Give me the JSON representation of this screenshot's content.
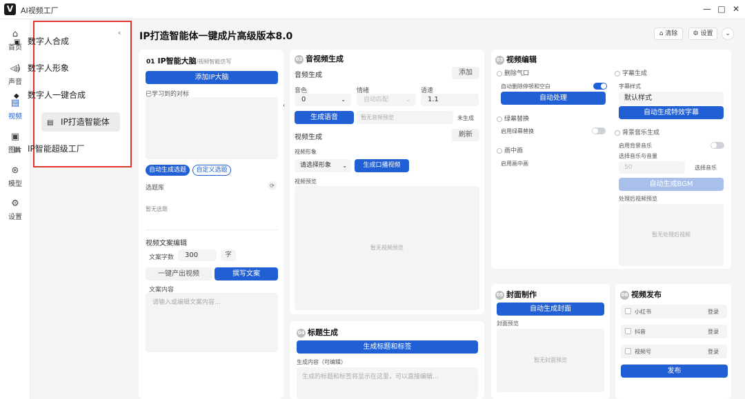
{
  "app": {
    "logo": "V",
    "title": "AI视频工厂"
  },
  "window": {
    "minimize": "—",
    "maximize": "□",
    "close": "✕"
  },
  "nav": [
    {
      "icon": "⌂",
      "label": "首页"
    },
    {
      "icon": "◁)",
      "label": "声音"
    },
    {
      "icon": "▤",
      "label": "视频"
    },
    {
      "icon": "▣",
      "label": "图片"
    },
    {
      "icon": "⊛",
      "label": "模型"
    },
    {
      "icon": "⚙",
      "label": "设置"
    }
  ],
  "submenu": {
    "collapse": "‹",
    "items": [
      {
        "icon": "▣",
        "label": "数字人合成"
      },
      {
        "icon": "▭",
        "label": "数字人形象"
      },
      {
        "icon": "◆",
        "label": "数字人一键合成"
      },
      {
        "icon": "▤",
        "label": "IP打造智能体"
      },
      {
        "icon": "▤",
        "label": "IP智能超级工厂"
      }
    ]
  },
  "header": {
    "title": "IP打造智能体一键成片高级版本8.0",
    "clear": "清除",
    "settings": "设置",
    "more": "⌄"
  },
  "s1": {
    "num": "01",
    "title": "IP智能大脑",
    "subtitle": "/视频智能仿写",
    "add_brain": "添加IP大脑",
    "learned_label": "已学习到的对标",
    "auto_topic": "自动生成选题",
    "custom_topic": "自定义选题",
    "topic_lib": "选题库",
    "refresh_icon": "⟳",
    "no_topic": "暂无选题",
    "copy_edit": "视频文案编辑",
    "word_count_label": "文案字数",
    "word_count": "300",
    "word_unit": "字",
    "one_click": "一键产出视频",
    "write_copy": "撰写文案",
    "content_label": "文案内容",
    "content_placeholder": "请输入或编辑文案内容..."
  },
  "s2": {
    "num": "02",
    "title": "音视频生成",
    "audio_gen": "音频生成",
    "add": "添加",
    "timbre_label": "音色",
    "timbre": "0",
    "emotion_label": "情绪",
    "emotion": "自动匹配",
    "speed_label": "语速",
    "speed": "1.1",
    "gen_voice": "生成语音",
    "no_audio": "暂无音频预览",
    "not_generated": "未生成",
    "video_gen": "视频生成",
    "refresh": "刷新",
    "figure_label": "视频形象",
    "figure_select": "请选择形象",
    "gen_video": "生成口播视频",
    "preview_label": "视频预览",
    "no_video": "暂无视频预览"
  },
  "s3": {
    "num": "03",
    "title": "视频编辑",
    "remove_breath": "删除气口",
    "auto_remove": "自动删除停顿和空白",
    "auto_process": "自动处理",
    "green_replace": "绿幕替换",
    "enable_green": "启用绿幕替换",
    "pip": "画中画",
    "enable_pip": "启用画中画",
    "subtitle_gen": "字幕生成",
    "subtitle_style": "字幕样式",
    "default_style": "默认样式",
    "auto_subtitle": "自动生成特效字幕",
    "bgm_gen": "背景音乐生成",
    "enable_bgm": "启用背景音乐",
    "bgm_volume_label": "选择音乐与音量",
    "bgm_volume": "50",
    "choose_music": "选择音乐",
    "auto_bgm": "自动生成BGM",
    "processed_preview": "处理后视频预览",
    "no_processed": "暂无处理后视频"
  },
  "s4": {
    "num": "04",
    "title": "标题生成",
    "gen_title": "生成标题和标签",
    "content_label": "生成内容（可编辑）",
    "content_placeholder": "生成的标题和标签将显示在这里，可以直接编辑..."
  },
  "s5": {
    "num": "05",
    "title": "封面制作",
    "auto_cover": "自动生成封面",
    "cover_preview": "封面预览",
    "no_cover": "暂无封面预览"
  },
  "s6": {
    "num": "06",
    "title": "视频发布",
    "platforms": [
      {
        "name": "小红书",
        "action": "登录"
      },
      {
        "name": "抖音",
        "action": "登录"
      },
      {
        "name": "视频号",
        "action": "登录"
      }
    ],
    "publish": "发布"
  },
  "colors": {
    "accent": "#2160d4",
    "annotation": "#e0332c"
  }
}
